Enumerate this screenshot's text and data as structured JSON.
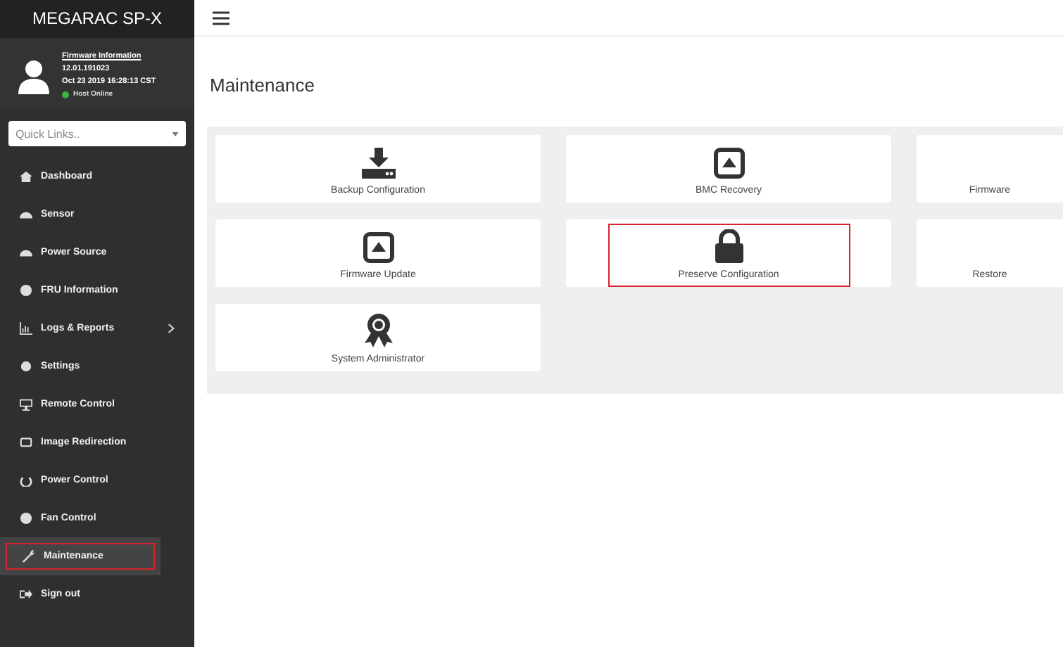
{
  "sidebar": {
    "brand": "MEGARAC SP-X",
    "user": {
      "link": "Firmware Information",
      "version": "12.01.191023",
      "date": "Oct 23 2019 16:28:13 CST",
      "status": {
        "label": "Host Online",
        "color": "#3cb043"
      }
    },
    "quick_links": {
      "placeholder": "Quick Links.."
    },
    "items": [
      {
        "label": "Dashboard",
        "selected": false,
        "highlighted": false,
        "has_submenu": false
      },
      {
        "label": "Sensor",
        "selected": false,
        "highlighted": false,
        "has_submenu": false
      },
      {
        "label": "Power Source",
        "selected": false,
        "highlighted": false,
        "has_submenu": false
      },
      {
        "label": "FRU Information",
        "selected": false,
        "highlighted": false,
        "has_submenu": false
      },
      {
        "label": "Logs & Reports",
        "selected": false,
        "highlighted": false,
        "has_submenu": true
      },
      {
        "label": "Settings",
        "selected": false,
        "highlighted": false,
        "has_submenu": false
      },
      {
        "label": "Remote Control",
        "selected": false,
        "highlighted": false,
        "has_submenu": false
      },
      {
        "label": "Image Redirection",
        "selected": false,
        "highlighted": false,
        "has_submenu": false
      },
      {
        "label": "Power Control",
        "selected": false,
        "highlighted": false,
        "has_submenu": false
      },
      {
        "label": "Fan Control",
        "selected": false,
        "highlighted": false,
        "has_submenu": false
      },
      {
        "label": "Maintenance",
        "selected": true,
        "highlighted": true,
        "has_submenu": false
      },
      {
        "label": "Sign out",
        "selected": false,
        "highlighted": false,
        "has_submenu": false
      }
    ]
  },
  "page": {
    "title": "Maintenance",
    "cards": [
      {
        "kind": "download",
        "label": "Backup Configuration",
        "highlighted": false
      },
      {
        "kind": "upload",
        "label": "BMC Recovery",
        "highlighted": false
      },
      {
        "kind": "none",
        "label": "Firmware",
        "highlighted": false
      },
      {
        "kind": "upload",
        "label": "Firmware Update",
        "highlighted": false
      },
      {
        "kind": "lock",
        "label": "Preserve Configuration",
        "highlighted": true
      },
      {
        "kind": "none",
        "label": "Restore",
        "highlighted": false
      },
      {
        "kind": "award",
        "label": "System Administrator",
        "highlighted": false
      }
    ]
  }
}
